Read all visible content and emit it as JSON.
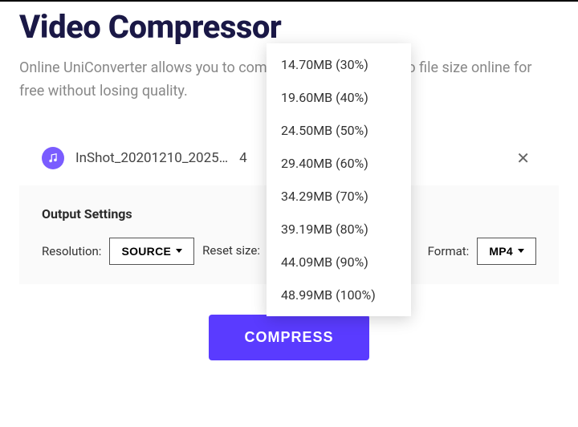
{
  "header": {
    "title": "Video Compressor",
    "subtitle": "Online UniConverter allows you to compress and reduce video file size online for free without losing quality."
  },
  "file": {
    "name": "InShot_20201210_2025…",
    "size_partial": "4"
  },
  "settings": {
    "heading": "Output Settings",
    "resolution_label": "Resolution:",
    "resolution_value": "SOURCE",
    "reset_size_label": "Reset size:",
    "reset_size_value": "34.29MB (70%)",
    "format_label": "Format:",
    "format_value": "MP4"
  },
  "dropdown": {
    "items": [
      "14.70MB (30%)",
      "19.60MB (40%)",
      "24.50MB (50%)",
      "29.40MB (60%)",
      "34.29MB (70%)",
      "39.19MB (80%)",
      "44.09MB (90%)",
      "48.99MB (100%)"
    ]
  },
  "actions": {
    "compress": "COMPRESS"
  }
}
